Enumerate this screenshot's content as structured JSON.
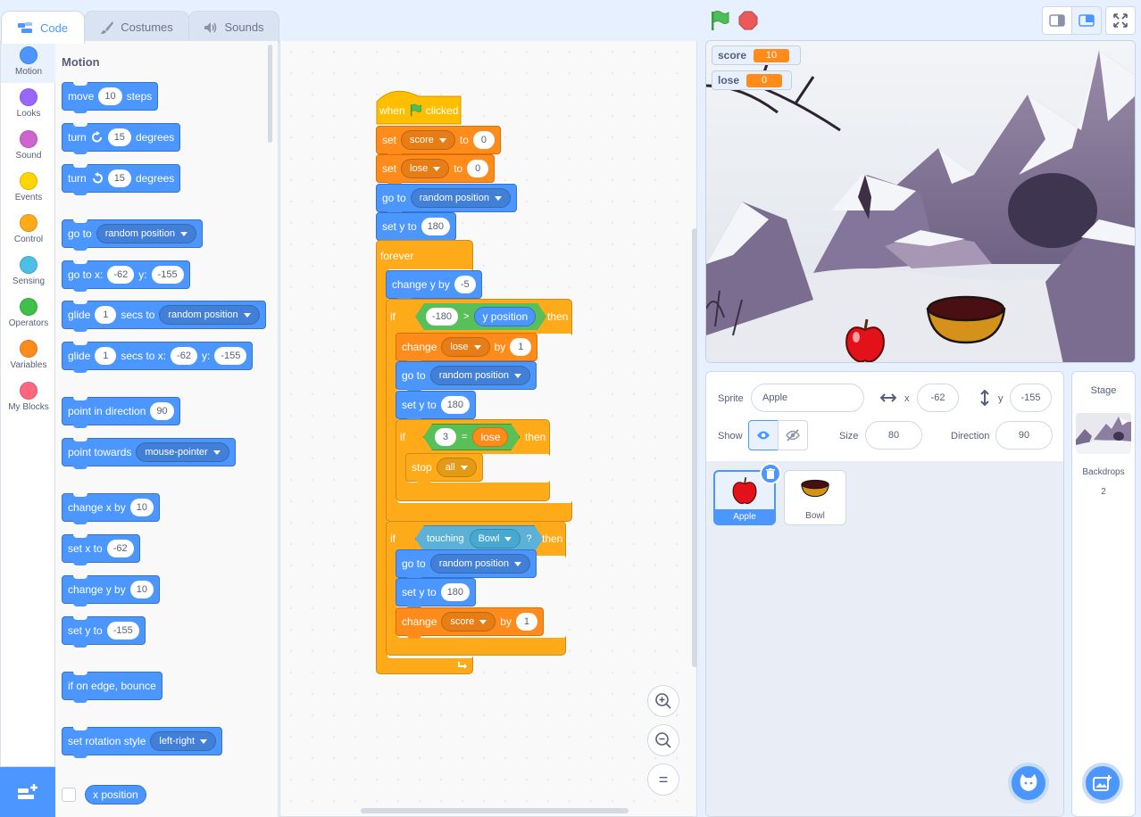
{
  "tabs": [
    {
      "label": "Code"
    },
    {
      "label": "Costumes"
    },
    {
      "label": "Sounds"
    }
  ],
  "categories": [
    {
      "label": "Motion",
      "color": "#4c97ff"
    },
    {
      "label": "Looks",
      "color": "#9966ff"
    },
    {
      "label": "Sound",
      "color": "#cf63cf"
    },
    {
      "label": "Events",
      "color": "#ffd500"
    },
    {
      "label": "Control",
      "color": "#ffab19"
    },
    {
      "label": "Sensing",
      "color": "#4cbfe6"
    },
    {
      "label": "Operators",
      "color": "#40bf4a"
    },
    {
      "label": "Variables",
      "color": "#ff8c1a"
    },
    {
      "label": "My Blocks",
      "color": "#ff6680"
    }
  ],
  "palette": {
    "title": "Motion",
    "move": {
      "text": "move",
      "val": "10",
      "unit": "steps"
    },
    "turn_right": {
      "text": "turn",
      "val": "15",
      "unit": "degrees"
    },
    "turn_left": {
      "text": "turn",
      "val": "15",
      "unit": "degrees"
    },
    "goto": {
      "text": "go to",
      "option": "random position"
    },
    "goto_xy": {
      "text": "go to x:",
      "x": "-62",
      "ylabel": "y:",
      "y": "-155"
    },
    "glide1": {
      "text": "glide",
      "secs": "1",
      "mid": "secs to",
      "option": "random position"
    },
    "glide2": {
      "text": "glide",
      "secs": "1",
      "mid": "secs to x:",
      "x": "-62",
      "ylabel": "y:",
      "y": "-155"
    },
    "point_dir": {
      "text": "point in direction",
      "val": "90"
    },
    "point_towards": {
      "text": "point towards",
      "option": "mouse-pointer"
    },
    "change_x": {
      "text": "change x by",
      "val": "10"
    },
    "set_x": {
      "text": "set x to",
      "val": "-62"
    },
    "change_y": {
      "text": "change y by",
      "val": "10"
    },
    "set_y": {
      "text": "set y to",
      "val": "-155"
    },
    "bounce": {
      "text": "if on edge, bounce"
    },
    "rot_style": {
      "text": "set rotation style",
      "option": "left-right"
    },
    "x_position": {
      "text": "x position"
    }
  },
  "script": {
    "hat": {
      "when": "when",
      "clicked": "clicked"
    },
    "set_score": {
      "text": "set",
      "var": "score",
      "to": "to",
      "val": "0"
    },
    "set_lose": {
      "text": "set",
      "var": "lose",
      "to": "to",
      "val": "0"
    },
    "goto": {
      "text": "go to",
      "option": "random position"
    },
    "set_y": {
      "text": "set y to",
      "val": "180"
    },
    "forever": "forever",
    "change_y": {
      "text": "change y by",
      "val": "-5"
    },
    "if1": {
      "if": "if",
      "left": "-180",
      "op": ">",
      "right": "y position",
      "then": "then"
    },
    "change_lose": {
      "text": "change",
      "var": "lose",
      "by": "by",
      "val": "1"
    },
    "goto2": {
      "text": "go to",
      "option": "random position"
    },
    "set_y2": {
      "text": "set y to",
      "val": "180"
    },
    "if2": {
      "if": "if",
      "left": "3",
      "op": "=",
      "right": "lose",
      "then": "then"
    },
    "stop": {
      "text": "stop",
      "option": "all"
    },
    "if3": {
      "if": "if",
      "sensor": "touching",
      "option": "Bowl",
      "q": "?",
      "then": "then"
    },
    "goto3": {
      "text": "go to",
      "option": "random position"
    },
    "set_y3": {
      "text": "set y to",
      "val": "180"
    },
    "change_score": {
      "text": "change",
      "var": "score",
      "by": "by",
      "val": "1"
    }
  },
  "zoom": {
    "in": "+",
    "out": "−",
    "reset": "="
  },
  "monitors": [
    {
      "name": "score",
      "value": "10"
    },
    {
      "name": "lose",
      "value": "0"
    }
  ],
  "sprite": {
    "label": "Sprite",
    "name": "Apple",
    "x_label": "x",
    "x": "-62",
    "y_label": "y",
    "y": "-155",
    "show_label": "Show",
    "size_label": "Size",
    "size": "80",
    "dir_label": "Direction",
    "dir": "90"
  },
  "sprites": [
    {
      "name": "Apple"
    },
    {
      "name": "Bowl"
    }
  ],
  "stage_pane": {
    "title": "Stage",
    "backdrops_label": "Backdrops",
    "backdrops_count": "2"
  },
  "colors": {
    "motion": "#4c97ff",
    "control": "#ffab19",
    "variables": "#ff8c1a",
    "operators": "#59c059",
    "sensing": "#5cb1d6",
    "events": "#ffbf00",
    "accent": "#4c97ff"
  }
}
